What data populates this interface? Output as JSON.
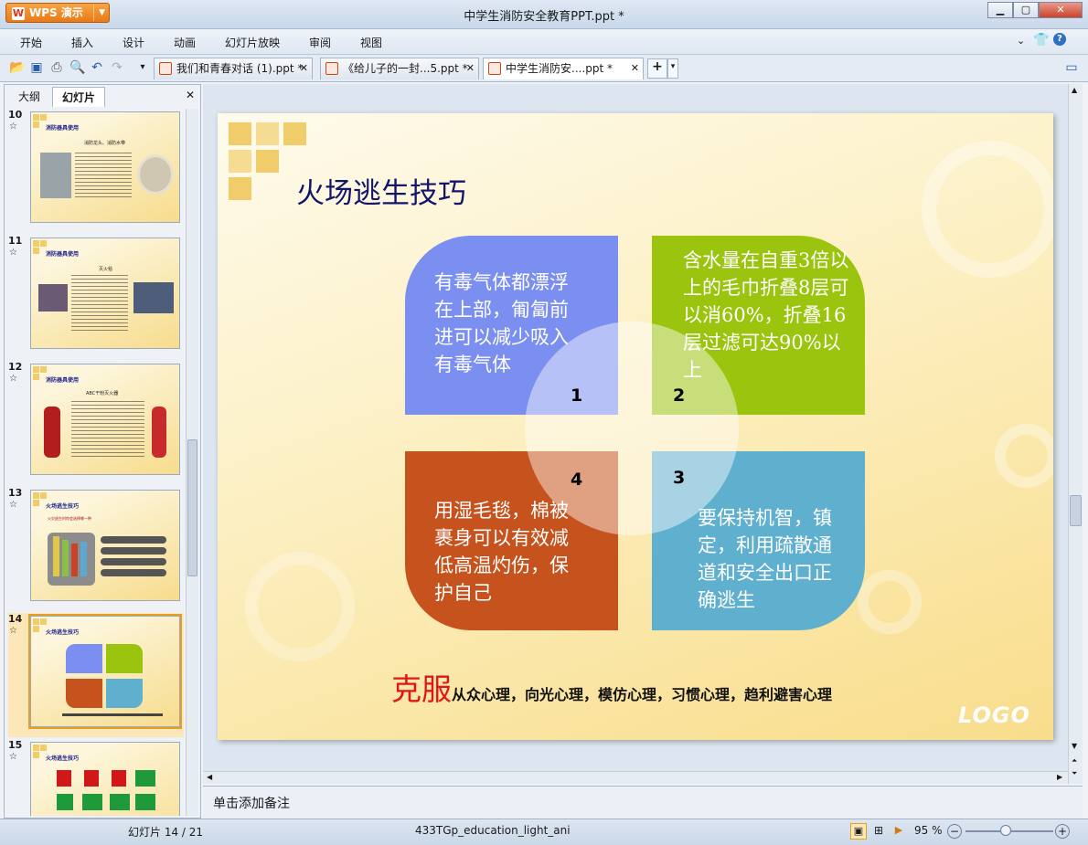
{
  "app": {
    "name": "WPS 演示",
    "document_title": "中学生消防安全教育PPT.ppt *"
  },
  "menu": [
    "开始",
    "插入",
    "设计",
    "动画",
    "幻灯片放映",
    "审阅",
    "视图"
  ],
  "tabs": [
    {
      "label": "我们和青春对话 (1).ppt *"
    },
    {
      "label": "《给儿子的一封...5.ppt *"
    },
    {
      "label": "中学生消防安....ppt *"
    }
  ],
  "left_pane": {
    "tabs": [
      "大纲",
      "幻灯片"
    ],
    "thumbnails": [
      {
        "num": "10",
        "title": "消防器具使用",
        "sub": "消防龙头、消防水带"
      },
      {
        "num": "11",
        "title": "消防器具使用",
        "sub": "灭火毯"
      },
      {
        "num": "12",
        "title": "消防器具使用",
        "sub": "ABC干粉灭火器"
      },
      {
        "num": "13",
        "title": "火场逃生技巧",
        "sub": "火灾逃生时你会选择哪一种"
      },
      {
        "num": "14",
        "title": "火场逃生技巧",
        "sub": ""
      },
      {
        "num": "15",
        "title": "火场逃生技巧",
        "sub": ""
      }
    ]
  },
  "slide": {
    "title": "火场逃生技巧",
    "petals": [
      {
        "num": "1",
        "text": "有毒气体都漂浮在上部，匍匐前进可以减少吸入有毒气体",
        "color": "#7b8ff0"
      },
      {
        "num": "2",
        "text": "含水量在自重3倍以上的毛巾折叠8层可以消60%，折叠16层过滤可达90%以上",
        "color": "#9bc40e"
      },
      {
        "num": "3",
        "text": "要保持机智，镇定，利用疏散通道和安全出口正确逃生",
        "color": "#5fafce"
      },
      {
        "num": "4",
        "text": "用湿毛毯，棉被裹身可以有效减低高温灼伤，保护自己",
        "color": "#c6521d"
      }
    ],
    "overcome_big": "克服",
    "overcome_rest": "从众心理，向光心理，模仿心理，习惯心理，趋利避害心理",
    "logo": "LOGO"
  },
  "notes": {
    "placeholder": "单击添加备注"
  },
  "status": {
    "slide_pos": "幻灯片 14 / 21",
    "template": "433TGp_education_light_ani",
    "zoom": "95 %"
  }
}
